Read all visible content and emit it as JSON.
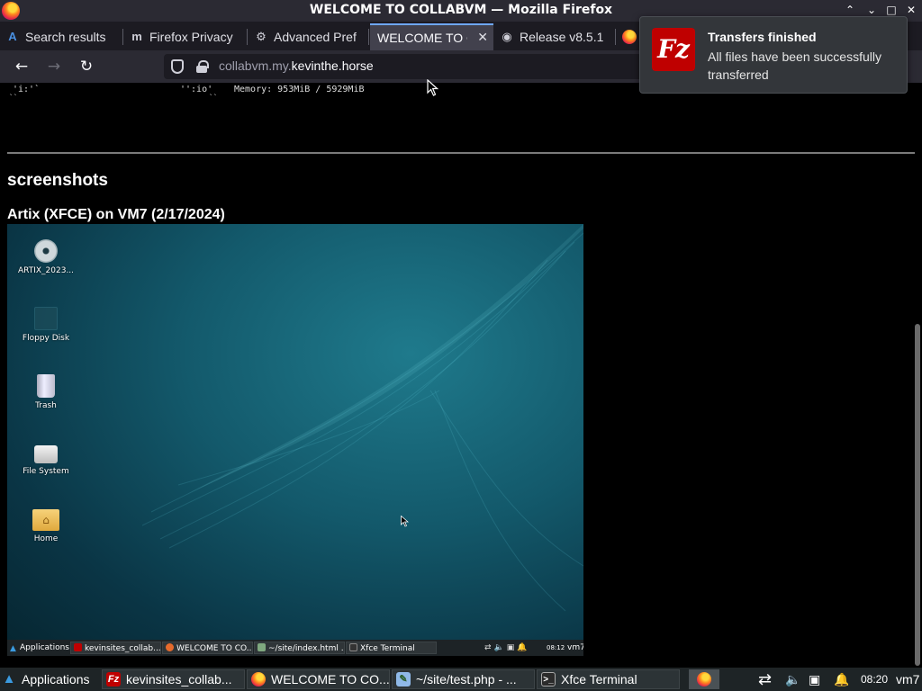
{
  "window": {
    "title": "WELCOME TO COLLABVM — Mozilla Firefox"
  },
  "tabs": [
    {
      "label": "Search results",
      "icon": "search-results-icon"
    },
    {
      "label": "Firefox Privacy",
      "icon": "mdn-icon"
    },
    {
      "label": "Advanced Pref",
      "icon": "gear-icon"
    },
    {
      "label": "WELCOME TO C",
      "icon": "",
      "active": true
    },
    {
      "label": "Release v8.5.1",
      "icon": "github-icon"
    },
    {
      "label": "",
      "icon": "firefox-icon"
    }
  ],
  "navbar": {
    "url_prefix": "collabvm.my.",
    "url_domain": "kevinthe.horse"
  },
  "page": {
    "ascii_line1": "'i:'`",
    "ascii_line1b": "'':io'",
    "memory": "Memory: 953MiB / 5929MiB",
    "ascii_line2": "``",
    "ascii_line2b": "``",
    "section_heading": "screenshots",
    "caption": "Artix (XFCE) on VM7 (2/17/2024)"
  },
  "vm_screenshot": {
    "desktop_icons": [
      {
        "label": "ARTIX_2023...",
        "icon": "disc-icon"
      },
      {
        "label": "Floppy Disk",
        "icon": "floppy-disk-icon"
      },
      {
        "label": "Trash",
        "icon": "trash-icon"
      },
      {
        "label": "File System",
        "icon": "drive-icon"
      },
      {
        "label": "Home",
        "icon": "home-folder-icon"
      }
    ],
    "taskbar": {
      "applications": "Applications",
      "windows": [
        "kevinsites_collab...",
        "WELCOME TO CO...",
        "~/site/index.html ...",
        "Xfce Terminal"
      ],
      "clock": "08:12",
      "host": "vm7"
    }
  },
  "taskbar": {
    "applications": "Applications",
    "windows": [
      "kevinsites_collab...",
      "WELCOME TO CO...",
      "~/site/test.php - ...",
      "Xfce Terminal"
    ],
    "clock": "08:20",
    "host": "vm7"
  },
  "notification": {
    "title": "Transfers finished",
    "body": "All files have been successfully transferred",
    "app_icon": "filezilla-icon"
  },
  "colors": {
    "accent": "#6fa8ff",
    "filezilla_red": "#bf0000",
    "firefox_chrome": "#2b2a33"
  }
}
